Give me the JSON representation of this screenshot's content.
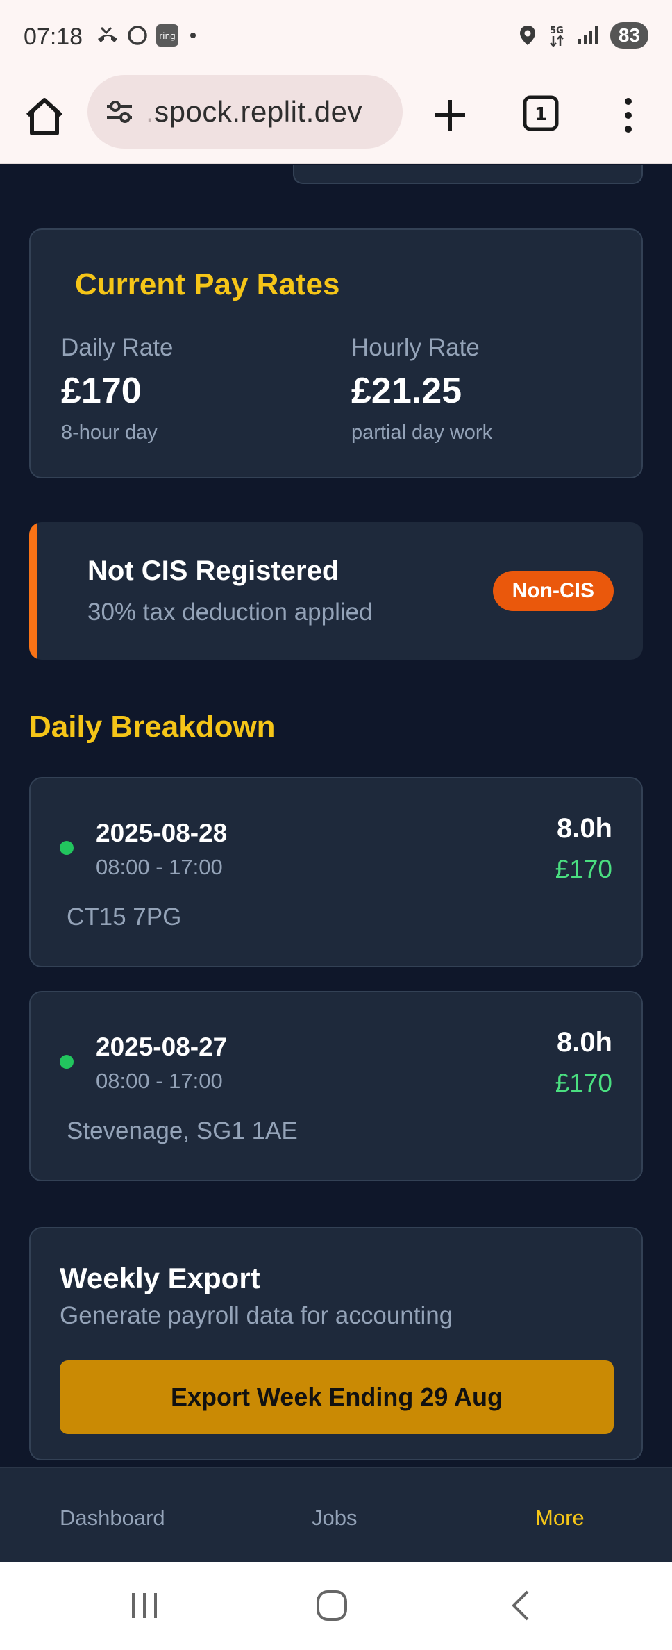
{
  "status_bar": {
    "time": "07:18",
    "battery": "83",
    "network": "5G"
  },
  "browser": {
    "url_prefix": ".",
    "url": "spock.replit.dev",
    "tab_count": "1"
  },
  "pay_rates": {
    "title": "Current Pay Rates",
    "daily": {
      "label": "Daily Rate",
      "value": "£170",
      "sub": "8-hour day"
    },
    "hourly": {
      "label": "Hourly Rate",
      "value": "£21.25",
      "sub": "partial day work"
    }
  },
  "cis": {
    "title": "Not CIS Registered",
    "subtitle": "30% tax deduction applied",
    "badge": "Non-CIS",
    "accent_color": "#f97316"
  },
  "breakdown": {
    "title": "Daily Breakdown",
    "days": [
      {
        "date": "2025-08-28",
        "time": "08:00 - 17:00",
        "hours": "8.0h",
        "pay": "£170",
        "location": "CT15 7PG"
      },
      {
        "date": "2025-08-27",
        "time": "08:00 - 17:00",
        "hours": "8.0h",
        "pay": "£170",
        "location": "Stevenage, SG1 1AE"
      }
    ]
  },
  "export": {
    "title": "Weekly Export",
    "subtitle": "Generate payroll data for accounting",
    "button": "Export Week Ending 29 Aug"
  },
  "bottom_nav": {
    "items": [
      {
        "label": "Dashboard",
        "active": false
      },
      {
        "label": "Jobs",
        "active": false
      },
      {
        "label": "More",
        "active": true
      }
    ]
  },
  "colors": {
    "accent": "#f5c518",
    "background": "#0f172a",
    "card": "#1e293b",
    "success": "#22c55e"
  }
}
